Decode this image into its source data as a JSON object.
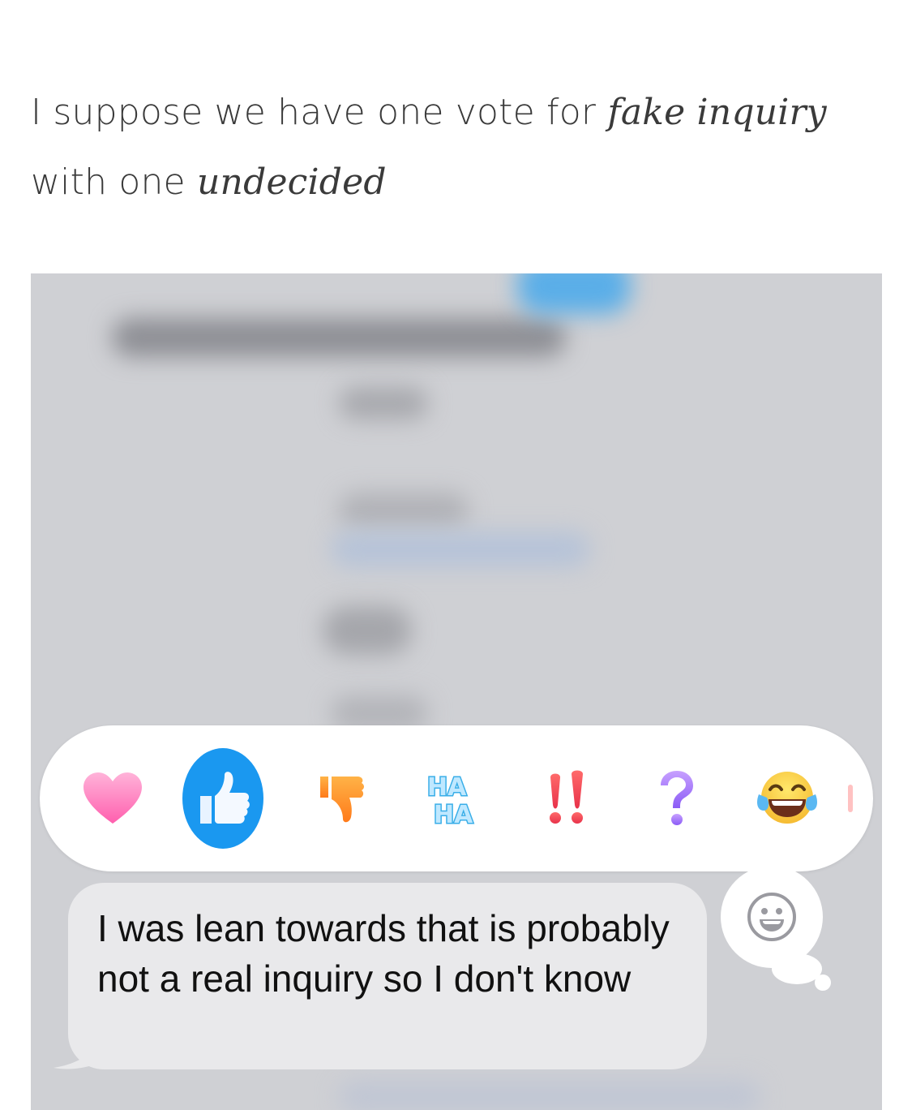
{
  "caption": {
    "line1_prefix": "I suppose we have one vote for ",
    "line1_emphasis": "fake inquiry",
    "line2_prefix": "with one ",
    "line2_emphasis": "undecided"
  },
  "reactions": [
    {
      "name": "heart",
      "selected": false
    },
    {
      "name": "thumbs-up",
      "selected": true,
      "accent": "#1a98f0"
    },
    {
      "name": "thumbs-down",
      "selected": false
    },
    {
      "name": "haha",
      "selected": false,
      "label": "HA HA"
    },
    {
      "name": "double-exclamation",
      "selected": false
    },
    {
      "name": "question",
      "selected": false
    },
    {
      "name": "tears-of-joy",
      "selected": false
    }
  ],
  "message": {
    "text": "I was lean towards that is probably not a real inquiry so I don't know"
  },
  "colors": {
    "bubble": "#e9e9eb",
    "backdrop": "#cfd0d4",
    "selected": "#1a98f0"
  }
}
